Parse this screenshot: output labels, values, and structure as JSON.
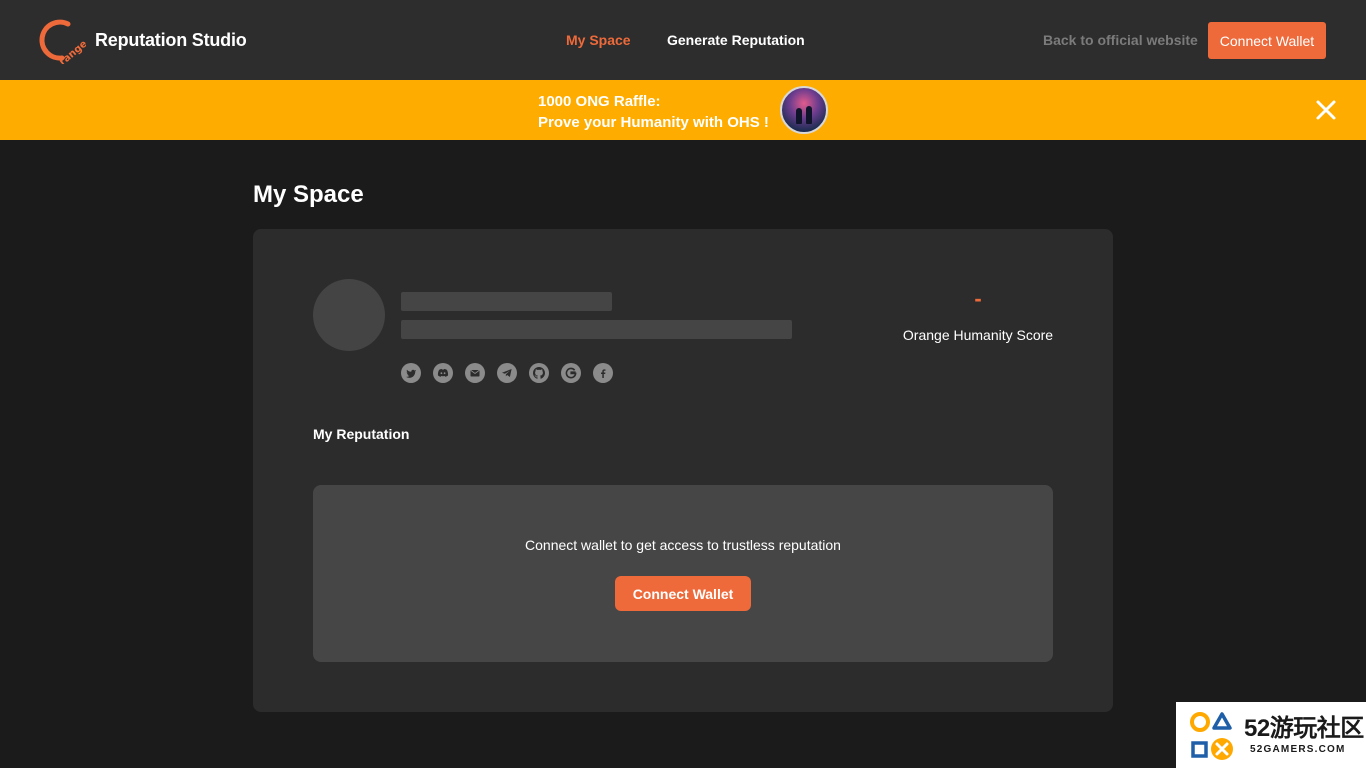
{
  "header": {
    "brand": "Reputation Studio",
    "nav": {
      "my_space": "My Space",
      "generate": "Generate Reputation"
    },
    "back_link": "Back to official website",
    "connect_wallet": "Connect Wallet"
  },
  "banner": {
    "line1": "1000 ONG Raffle:",
    "line2": "Prove your Humanity with OHS !"
  },
  "main": {
    "title": "My Space",
    "profile": {
      "social_icons": [
        "twitter-icon",
        "discord-icon",
        "mail-icon",
        "telegram-icon",
        "github-icon",
        "google-icon",
        "facebook-icon"
      ]
    },
    "score": {
      "value": "-",
      "label": "Orange Humanity Score"
    },
    "reputation": {
      "title": "My Reputation",
      "message": "Connect wallet to get access to trustless reputation",
      "button": "Connect Wallet"
    }
  },
  "watermark": {
    "big": "52游玩社区",
    "small": "52GAMERS.COM"
  },
  "colors": {
    "accent": "#ee6a3a",
    "banner": "#ffac00",
    "header_bg": "#2d2d2d",
    "page_bg": "#1b1b1b"
  }
}
